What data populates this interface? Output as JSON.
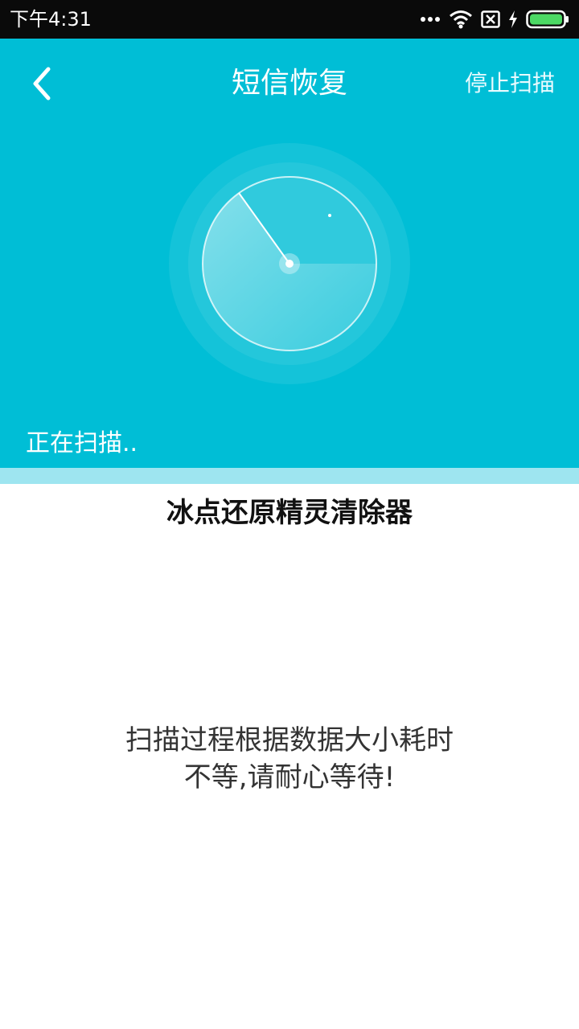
{
  "status_bar": {
    "time": "下午4:31",
    "icons": [
      "more-dots-icon",
      "wifi-icon",
      "no-sim-icon",
      "charging-icon",
      "battery-icon"
    ],
    "battery_color": "#4cd964"
  },
  "header": {
    "title": "短信恢复",
    "stop_label": "停止扫描",
    "scan_status": "正在扫描..",
    "background_color": "#00bed6"
  },
  "ad": {
    "title": "冰点还原精灵清除器"
  },
  "hint": {
    "line1": "扫描过程根据数据大小耗时",
    "line2": "不等,请耐心等待!"
  }
}
